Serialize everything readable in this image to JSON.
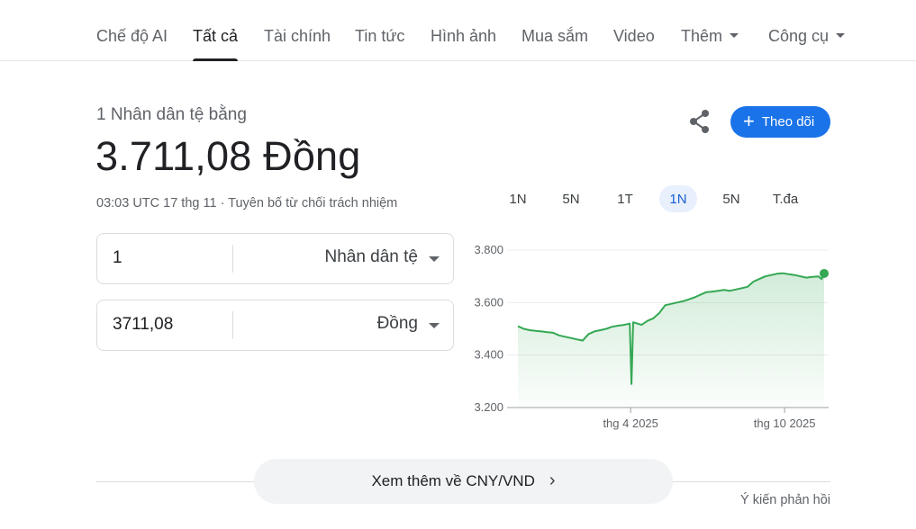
{
  "tabs": [
    {
      "label": "Chế độ AI",
      "active": false,
      "dropdown": false
    },
    {
      "label": "Tất cả",
      "active": true,
      "dropdown": false
    },
    {
      "label": "Tài chính",
      "active": false,
      "dropdown": false
    },
    {
      "label": "Tin tức",
      "active": false,
      "dropdown": false
    },
    {
      "label": "Hình ảnh",
      "active": false,
      "dropdown": false
    },
    {
      "label": "Mua sắm",
      "active": false,
      "dropdown": false
    },
    {
      "label": "Video",
      "active": false,
      "dropdown": false
    },
    {
      "label": "Thêm",
      "active": false,
      "dropdown": true
    },
    {
      "label": "Công cụ",
      "active": false,
      "dropdown": true
    }
  ],
  "currency": {
    "subtitle": "1 Nhân dân tệ bằng",
    "value": "3.711,08 Đồng",
    "meta": "03:03 UTC 17 thg 11 · Tuyên bố từ chối trách nhiệm",
    "follow_label": "Theo dõi",
    "share_icon": "share-icon"
  },
  "converter": {
    "from": {
      "amount": "1",
      "unit": "Nhân dân tệ"
    },
    "to": {
      "amount": "3711,08",
      "unit": "Đồng"
    }
  },
  "ranges": [
    {
      "label": "1N",
      "active": false
    },
    {
      "label": "5N",
      "active": false
    },
    {
      "label": "1T",
      "active": false
    },
    {
      "label": "1N",
      "active": true
    },
    {
      "label": "5N",
      "active": false
    },
    {
      "label": "T.đa",
      "active": false
    }
  ],
  "chart_data": {
    "type": "area",
    "title": "",
    "xlabel": "",
    "ylabel": "",
    "ylim": [
      3200,
      3800
    ],
    "yticks": [
      "3.800",
      "3.600",
      "3.400",
      "3.200"
    ],
    "xticks": [
      {
        "label": "thg 4 2025",
        "x": "2025-04-01"
      },
      {
        "label": "thg 10 2025",
        "x": "2025-10-01"
      }
    ],
    "color": "#34a853",
    "points": [
      [
        "2024-11-18",
        3510
      ],
      [
        "2024-11-25",
        3500
      ],
      [
        "2024-12-02",
        3495
      ],
      [
        "2024-12-09",
        3492
      ],
      [
        "2024-12-16",
        3490
      ],
      [
        "2024-12-23",
        3487
      ],
      [
        "2024-12-30",
        3485
      ],
      [
        "2025-01-06",
        3475
      ],
      [
        "2025-01-13",
        3470
      ],
      [
        "2025-01-20",
        3465
      ],
      [
        "2025-01-27",
        3460
      ],
      [
        "2025-02-03",
        3455
      ],
      [
        "2025-02-10",
        3480
      ],
      [
        "2025-02-17",
        3490
      ],
      [
        "2025-02-24",
        3495
      ],
      [
        "2025-03-03",
        3500
      ],
      [
        "2025-03-10",
        3508
      ],
      [
        "2025-03-17",
        3512
      ],
      [
        "2025-03-24",
        3515
      ],
      [
        "2025-03-31",
        3520
      ],
      [
        "2025-04-02",
        3290
      ],
      [
        "2025-04-04",
        3525
      ],
      [
        "2025-04-14",
        3515
      ],
      [
        "2025-04-21",
        3530
      ],
      [
        "2025-04-28",
        3540
      ],
      [
        "2025-05-05",
        3560
      ],
      [
        "2025-05-12",
        3590
      ],
      [
        "2025-05-19",
        3595
      ],
      [
        "2025-05-26",
        3600
      ],
      [
        "2025-06-02",
        3605
      ],
      [
        "2025-06-09",
        3612
      ],
      [
        "2025-06-16",
        3620
      ],
      [
        "2025-06-23",
        3630
      ],
      [
        "2025-06-30",
        3640
      ],
      [
        "2025-07-07",
        3642
      ],
      [
        "2025-07-14",
        3645
      ],
      [
        "2025-07-21",
        3648
      ],
      [
        "2025-07-28",
        3645
      ],
      [
        "2025-08-04",
        3650
      ],
      [
        "2025-08-11",
        3655
      ],
      [
        "2025-08-18",
        3660
      ],
      [
        "2025-08-25",
        3680
      ],
      [
        "2025-09-01",
        3690
      ],
      [
        "2025-09-08",
        3700
      ],
      [
        "2025-09-15",
        3705
      ],
      [
        "2025-09-22",
        3710
      ],
      [
        "2025-09-29",
        3712
      ],
      [
        "2025-10-06",
        3708
      ],
      [
        "2025-10-13",
        3705
      ],
      [
        "2025-10-20",
        3700
      ],
      [
        "2025-10-27",
        3695
      ],
      [
        "2025-11-03",
        3698
      ],
      [
        "2025-11-10",
        3700
      ],
      [
        "2025-11-14",
        3690
      ],
      [
        "2025-11-17",
        3711
      ]
    ]
  },
  "footer": {
    "more_label": "Xem thêm về CNY/VND",
    "feedback": "Ý kiến phản hồi"
  }
}
